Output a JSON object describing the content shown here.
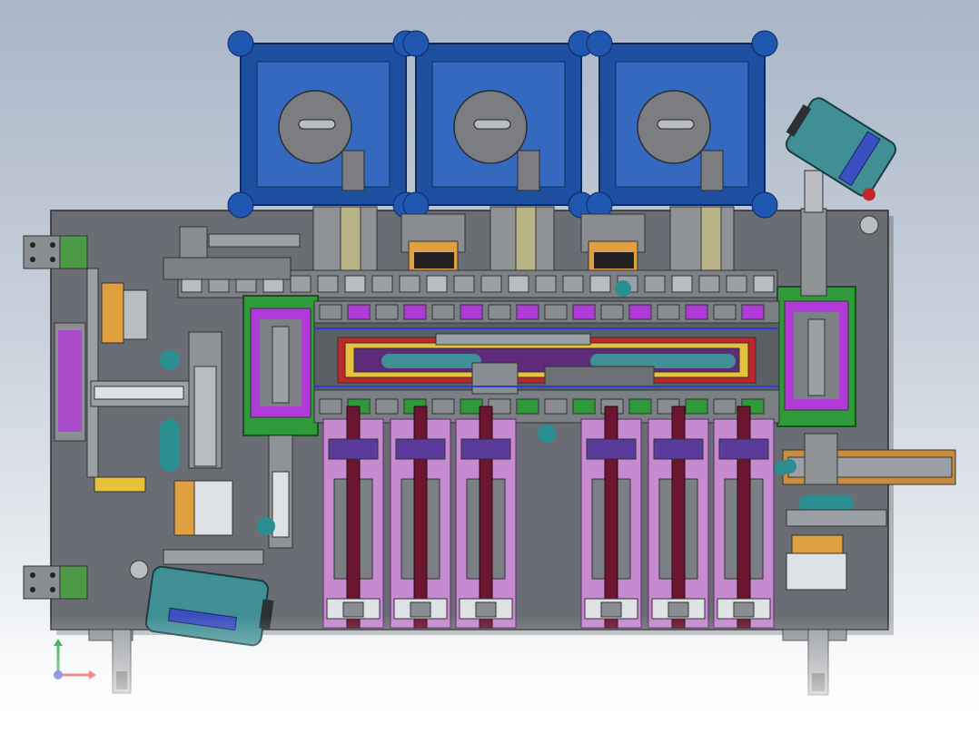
{
  "scene": {
    "description_visible": false,
    "colors": {
      "background_top": "#a9b6c7",
      "background_bottom": "#ffffff",
      "base_plate": "#6a6e74",
      "fan_blue": "#1e4fa0",
      "fan_housing": "#7c7d80",
      "frame_green": "#2f9a3a",
      "frame_magenta": "#b13bd8",
      "station_pink": "#c58ad0",
      "rod_maroon": "#6b1530",
      "rail_orange": "#c98b3d",
      "cylinder_teal": "#3f8f95",
      "accent_yellow": "#e6c13a",
      "accent_red": "#c0262b"
    },
    "icons": [
      "coordinate-triad-icon",
      "fan-unit-icon",
      "motor-unit-icon",
      "bracket-icon",
      "guide-rail-icon"
    ]
  }
}
